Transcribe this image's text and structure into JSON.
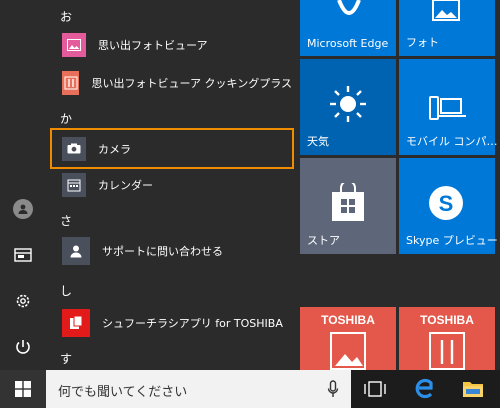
{
  "app_list": {
    "sections": [
      "お",
      "か",
      "さ",
      "し",
      "す"
    ],
    "apps": [
      {
        "label": "思い出フォトビューア",
        "color": "#e35b9a"
      },
      {
        "label": "思い出フォトビューア クッキングプラス",
        "color": "#e8705a"
      },
      {
        "label": "カメラ",
        "color": "#4a4f5c"
      },
      {
        "label": "カレンダー",
        "color": "#4a4f5c"
      },
      {
        "label": "サポートに問い合わせる",
        "color": "#4a4f5c"
      },
      {
        "label": "シュフーチラシアプリ for TOSHIBA",
        "color": "#e21a1a"
      }
    ]
  },
  "tiles": {
    "edge": "Microsoft Edge",
    "photos": "フォト",
    "weather": "天気",
    "mobile": "モバイル コンパ…",
    "store": "ストア",
    "skype": "Skype プレビュー",
    "toshiba1": "TOSHIBA",
    "toshiba2": "TOSHIBA"
  },
  "search": {
    "placeholder": "何でも聞いてください"
  },
  "colors": {
    "accent": "#0063b1",
    "tile_blue": "#0078d7",
    "selection": "#f08c00",
    "toshiba_tile": "#e3584a"
  }
}
